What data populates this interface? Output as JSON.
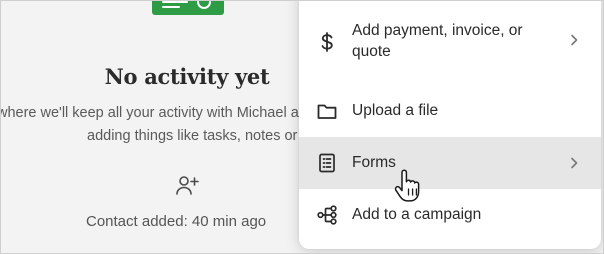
{
  "activity": {
    "empty_title": "No activity yet",
    "description_line1": "where we'll keep all your activity with Michael a",
    "description_line2": "adding things like tasks, notes or ema",
    "person_icon": "add-person-icon",
    "contact_added": "Contact added: 40 min ago",
    "illustration_color": "#2e9b45"
  },
  "menu": {
    "items": [
      {
        "label_line1": "Add payment, invoice, or",
        "label_line2": "quote",
        "icon": "dollar-icon",
        "has_submenu": true
      },
      {
        "label": "Upload a file",
        "icon": "folder-icon",
        "has_submenu": false
      },
      {
        "label": "Forms",
        "icon": "form-icon",
        "has_submenu": true,
        "hovered": true
      },
      {
        "label": "Add to a campaign",
        "icon": "campaign-flow-icon",
        "has_submenu": false
      }
    ],
    "hover_color": "#e6e6e6"
  },
  "cursor": {
    "icon": "hand-pointer-cursor-icon"
  }
}
